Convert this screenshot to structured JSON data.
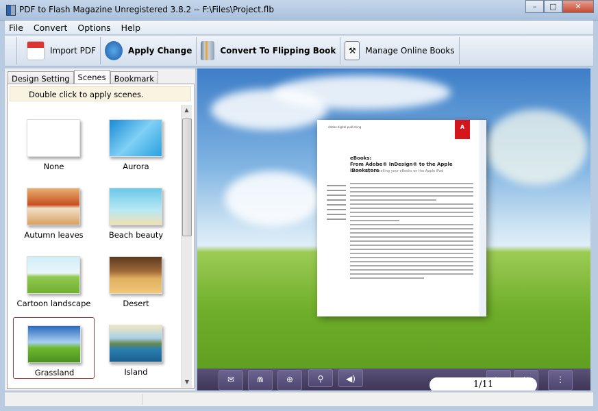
{
  "window": {
    "title": "PDF to Flash Magazine Unregistered 3.8.2  -- F:\\Files\\Project.flb",
    "minimize": "–",
    "maximize": "□",
    "close": "✕"
  },
  "menu": [
    "File",
    "Convert",
    "Options",
    "Help"
  ],
  "toolbar": {
    "import": "Import PDF",
    "apply": "Apply Change",
    "convert": "Convert To Flipping Book",
    "manage": "Manage Online Books"
  },
  "tabs": [
    "Design Setting",
    "Scenes",
    "Bookmark"
  ],
  "scenes": {
    "hint": "Double click to apply scenes.",
    "selected": "Grassland",
    "items": [
      "None",
      "Aurora",
      "Autumn leaves",
      "Beach beauty",
      "Cartoon landscape",
      "Desert",
      "Grassland",
      "Island"
    ]
  },
  "book": {
    "header": "Adobe digital publishing",
    "title1": "eBooks:",
    "title2": "From Adobe® InDesign® to the Apple iBookstore",
    "subtitle": "Distributing and selling your eBooks on the Apple iPad",
    "page": "1/11"
  },
  "colors": {
    "accent": "#a23a3a",
    "controlbar": "#4d4670"
  }
}
